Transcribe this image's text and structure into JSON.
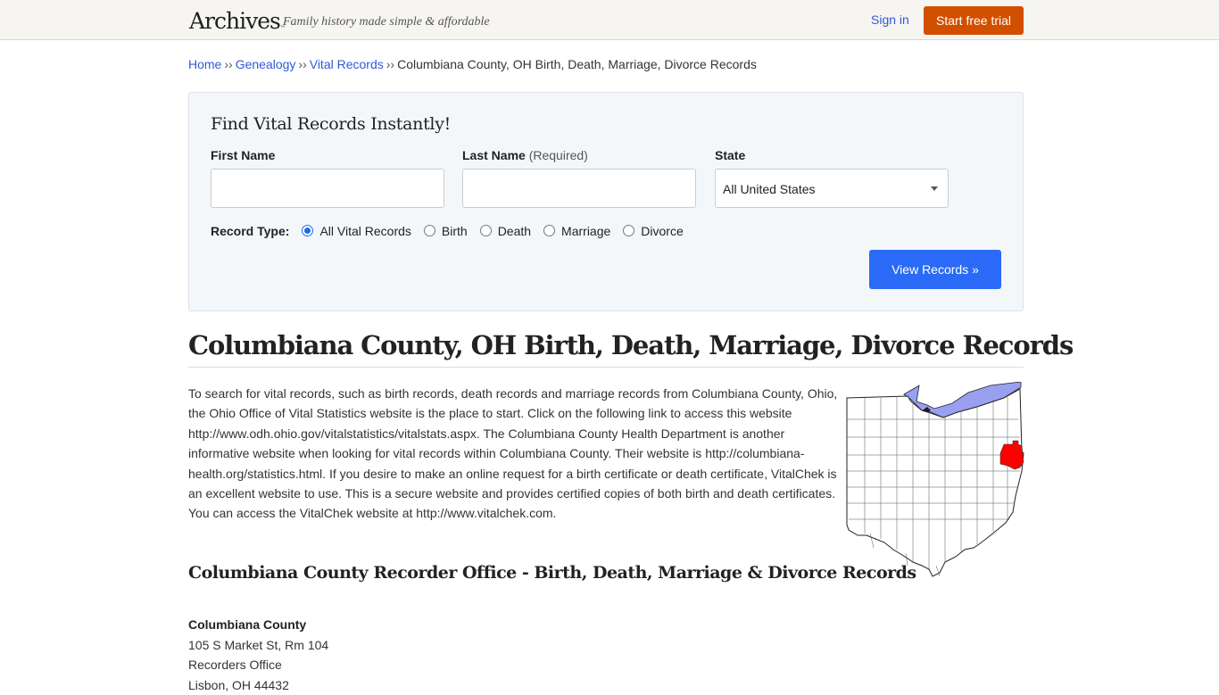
{
  "header": {
    "logo": "Archives",
    "logo_tm": "™",
    "tagline": "Family history made simple & affordable",
    "signin_label": "Sign in",
    "trial_label": "Start free trial"
  },
  "breadcrumb": {
    "items": [
      "Home",
      "Genealogy",
      "Vital Records"
    ],
    "separator": "››",
    "current": "Columbiana County, OH Birth, Death, Marriage, Divorce Records"
  },
  "search": {
    "title": "Find Vital Records Instantly!",
    "first_name_label": "First Name",
    "first_name_value": "",
    "last_name_label": "Last Name",
    "last_name_hint": "(Required)",
    "last_name_value": "",
    "state_label": "State",
    "state_value": "All United States",
    "record_type_label": "Record Type:",
    "record_types": [
      {
        "label": "All Vital Records",
        "checked": true
      },
      {
        "label": "Birth",
        "checked": false
      },
      {
        "label": "Death",
        "checked": false
      },
      {
        "label": "Marriage",
        "checked": false
      },
      {
        "label": "Divorce",
        "checked": false
      }
    ],
    "submit_label": "View Records »"
  },
  "main": {
    "title": "Columbiana County, OH Birth, Death, Marriage, Divorce Records",
    "intro": "To search for vital records, such as birth records, death records and marriage records from Columbiana County, Ohio, the Ohio Office of Vital Statistics website is the place to start. Click on the following link to access this website http://www.odh.ohio.gov/vitalstatistics/vitalstats.aspx. The Columbiana County Health Department is another informative website when looking for vital records within Columbiana County. Their website is http://columbiana-health.org/statistics.html. If you desire to make an online request for a birth certificate or death certificate, VitalChek is an excellent website to use. This is a secure website and provides certified copies of both birth and death certificates. You can access the VitalChek website at http://www.vitalchek.com.",
    "map": {
      "state": "Ohio",
      "highlighted_county": "Columbiana County",
      "colors": {
        "highlight": "#ff0000",
        "lake": "#9aa0f0",
        "land": "#ffffff",
        "border": "#444444"
      }
    },
    "section_title": "Columbiana County Recorder Office - Birth, Death, Marriage & Divorce Records",
    "office": {
      "name": "Columbiana County",
      "lines": [
        "105 S Market St, Rm 104",
        "Recorders Office",
        "Lisbon, OH 44432"
      ]
    }
  },
  "colors": {
    "link": "#2f5ad6",
    "trial_button": "#d24f00",
    "submit_button": "#2a6af6",
    "panel_bg": "#f4f7fa"
  }
}
